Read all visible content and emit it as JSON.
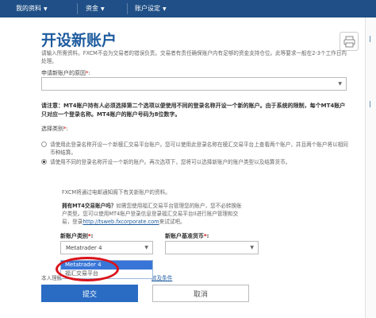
{
  "nav": {
    "items": [
      "我的资料",
      "资金",
      "账户设定"
    ]
  },
  "page": {
    "title": "开设新账户",
    "intro": "请输入所需资料。FXCM不会为交易者的错误负责。交易者有责任确保账户内有足够的资金支持仓位。此等要求一般在2-3个工作日内处理。"
  },
  "reason": {
    "label": "申请新账户的原因",
    "required_mark": "*",
    "value": ""
  },
  "note": "请注意：MT4账户持有人必须选择第二个选项以便使用不同的登录名称开设一个新的账户。由于系统的限制，每个MT4账户只对应一个登录名称。MT4账户的账户号码为8位数字。",
  "options": {
    "label": "选择类别",
    "required_mark": "*",
    "items": [
      {
        "text": "请使用此登录名称开设一个新模汇交易平台账户。您可以使用此登录名称在模汇交易平台上查看两个账户，并且两个账户将以相同币种结算。",
        "selected": false
      },
      {
        "text": "请使用不同的登录名称开设一个新的账户。再次选项下，您将可以选择新账户的账户类型以及结算货币。",
        "selected": true
      }
    ]
  },
  "panel": {
    "email_note": "FXCM将通过电邮通知阁下有关新账户的资料。",
    "question_bold": "拥有MT4交易账户吗？",
    "question_text": "如需您使用福汇交易平台管理您的账户，您不必转换账户类型。您可以使用MT4账户登录信息登录福汇交易平台II进行账户管理和交易，登录",
    "question_link": "http://tsweb.fxcorporate.com",
    "question_tail": "来试试吧。"
  },
  "account_type": {
    "label": "新账户类别",
    "required_mark": "*",
    "value": "Metatrader 4",
    "options": [
      "Metatrader 4",
      "福汇交易平台"
    ]
  },
  "currency": {
    "label": "新账户基准货币",
    "required_mark": "*",
    "value": ""
  },
  "agree": {
    "text": "本人理解",
    "link": "款及条件"
  },
  "buttons": {
    "submit": "提交",
    "cancel": "取消"
  },
  "colors": {
    "nav_bg": "#1f4f86",
    "title": "#1d5b9e",
    "submit_bg": "#2a6cc4",
    "highlight": "#d9141c",
    "selected_option": "#3875d7"
  }
}
